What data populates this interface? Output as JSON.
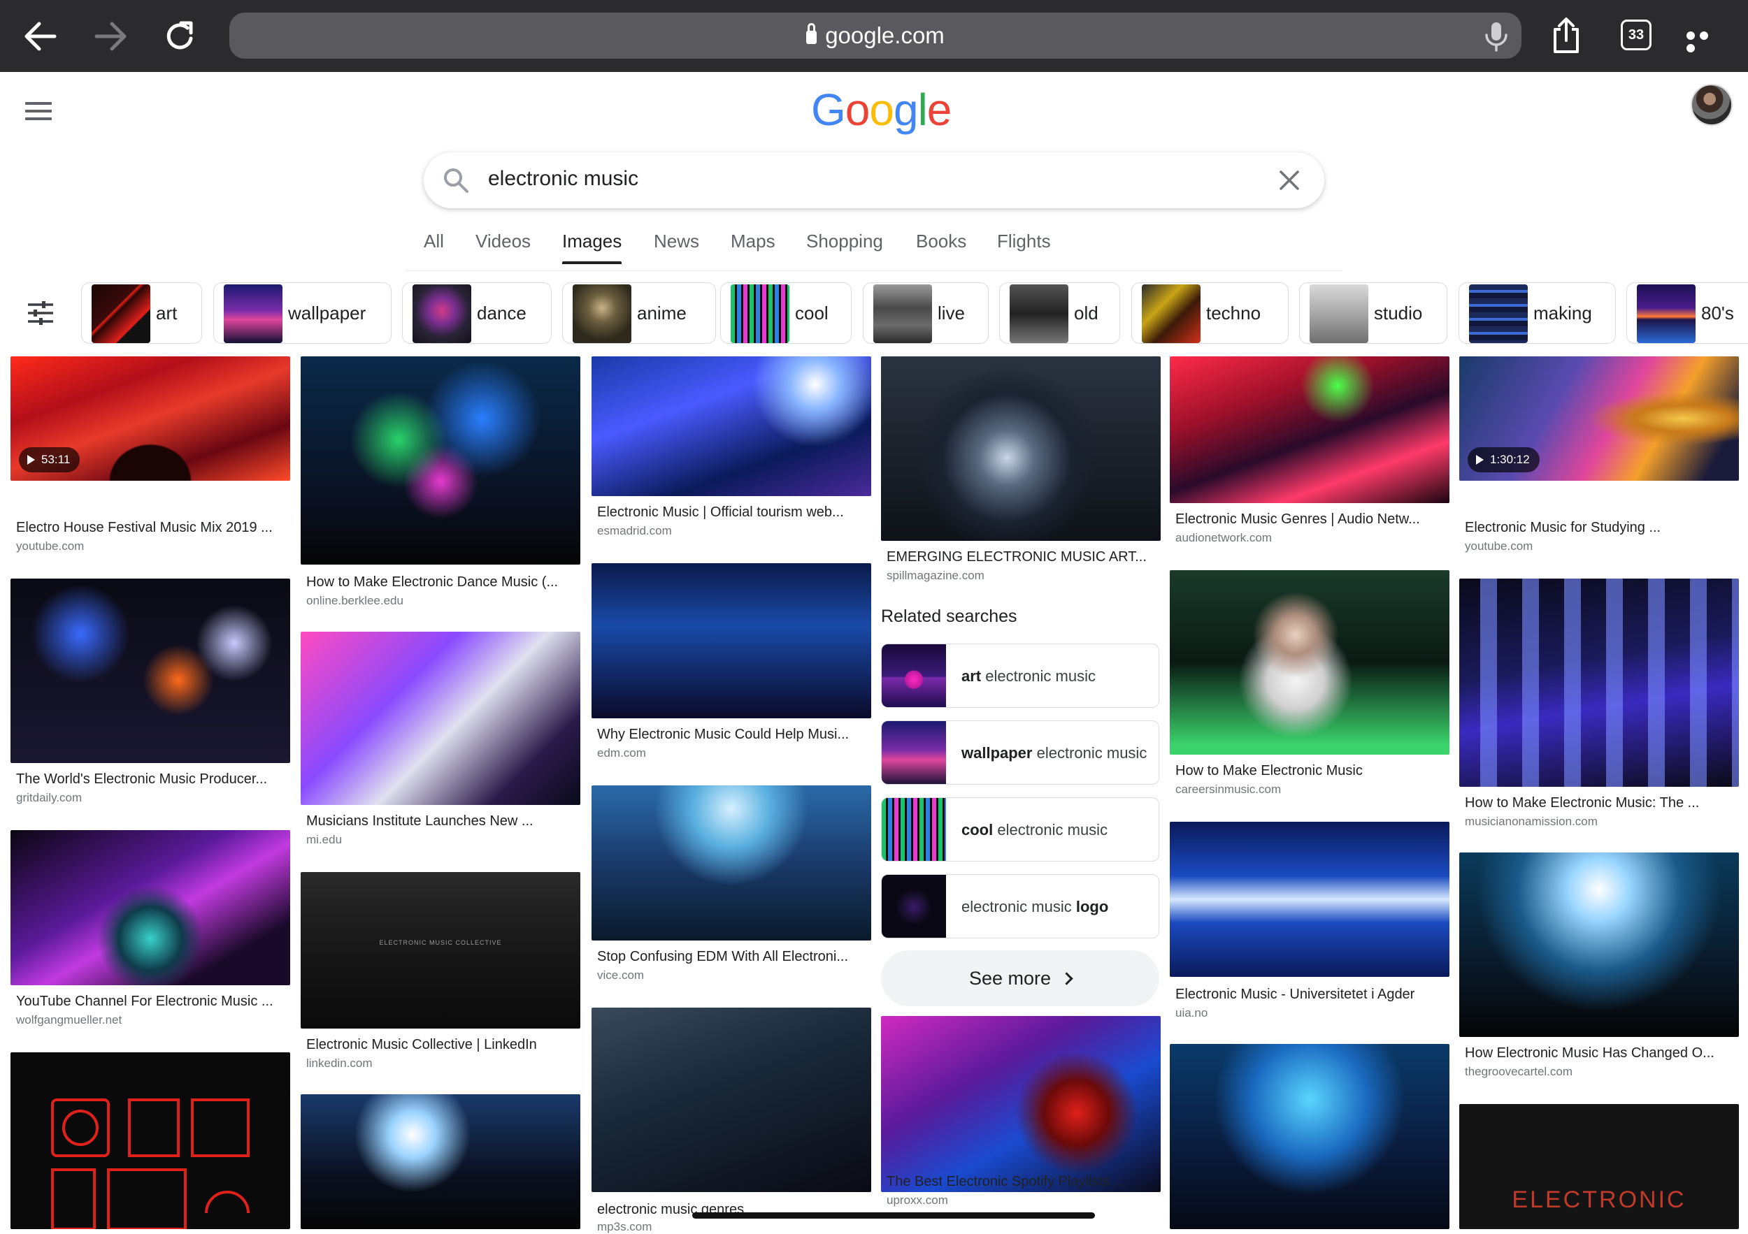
{
  "browser": {
    "url": "google.com",
    "tab_count": "33"
  },
  "search": {
    "query": "electronic music"
  },
  "tabs": [
    "All",
    "Videos",
    "Images",
    "News",
    "Maps",
    "Shopping",
    "Books",
    "Flights"
  ],
  "active_tab": "Images",
  "chips": [
    "art",
    "wallpaper",
    "dance",
    "anime",
    "cool",
    "live",
    "old",
    "techno",
    "studio",
    "making",
    "80's"
  ],
  "results": [
    {
      "title": "Electro House Festival Music Mix 2019 ...",
      "source": "youtube.com",
      "duration": "53:11"
    },
    {
      "title": "The World's Electronic Music Producer...",
      "source": "gritdaily.com"
    },
    {
      "title": "YouTube Channel For Electronic Music ...",
      "source": "wolfgangmueller.net"
    },
    {
      "title": "How to Make Electronic Dance Music (...",
      "source": "online.berklee.edu"
    },
    {
      "title": "Musicians Institute Launches New ...",
      "source": "mi.edu"
    },
    {
      "title": "Electronic Music Collective | LinkedIn",
      "source": "linkedin.com",
      "overlay": "ELECTRONIC MUSIC COLLECTIVE"
    },
    {
      "title": "Electronic Music | Official tourism web...",
      "source": "esmadrid.com"
    },
    {
      "title": "Why Electronic Music Could Help Musi...",
      "source": "edm.com"
    },
    {
      "title": "Stop Confusing EDM With All Electroni...",
      "source": "vice.com"
    },
    {
      "title": "electronic music genres",
      "source": "mp3s.com"
    },
    {
      "title": "EMERGING ELECTRONIC MUSIC ART...",
      "source": "spillmagazine.com"
    },
    {
      "title": "The Best Electronic Spotify Playlists ...",
      "source": "uproxx.com"
    },
    {
      "title": "Electronic Music Genres | Audio Netw...",
      "source": "audionetwork.com"
    },
    {
      "title": "How to Make Electronic Music",
      "source": "careersinmusic.com"
    },
    {
      "title": "Electronic Music - Universitetet i Agder",
      "source": "uia.no"
    },
    {
      "title": "Electronic Music for Studying ...",
      "source": "youtube.com",
      "duration": "1:30:12"
    },
    {
      "title": "How to Make Electronic Music: The ...",
      "source": "musicianonamission.com"
    },
    {
      "title": "How Electronic Music Has Changed O...",
      "source": "thegroovecartel.com"
    },
    {
      "overlay": "ELECTRONIC"
    }
  ],
  "related": {
    "title": "Related searches",
    "items": [
      {
        "bold": "art",
        "rest": " electronic music"
      },
      {
        "bold": "wallpaper",
        "rest": " electronic music"
      },
      {
        "bold": "cool",
        "rest": " electronic music"
      },
      {
        "pre": "electronic music ",
        "bold": "logo"
      }
    ],
    "see_more": "See more"
  }
}
